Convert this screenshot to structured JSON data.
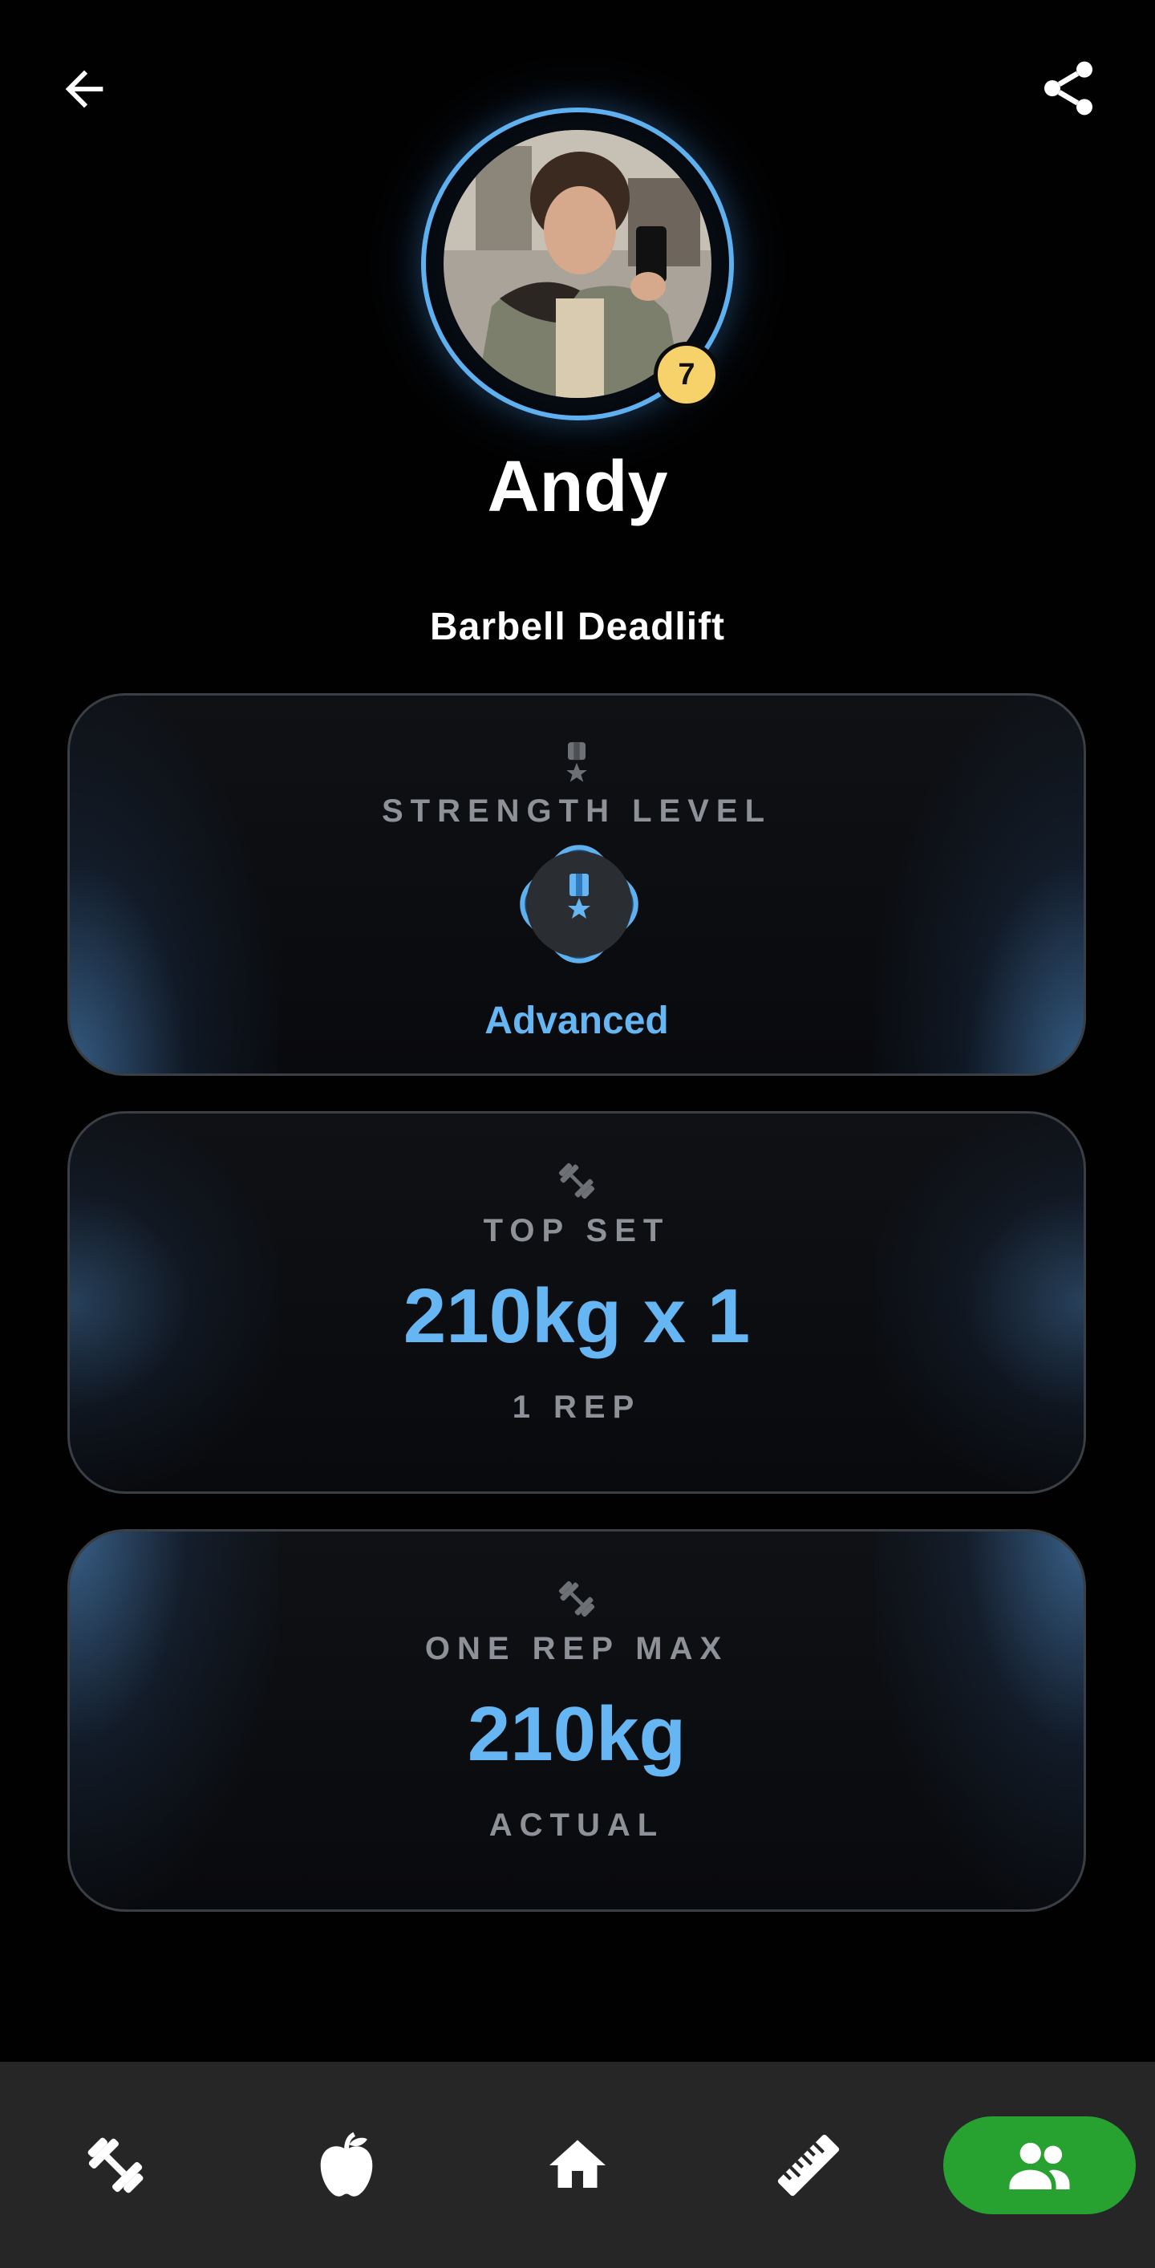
{
  "header": {
    "back_icon": "arrow-left-icon",
    "share_icon": "share-icon"
  },
  "profile": {
    "name": "Andy",
    "level": "7",
    "ring_color": "#5fb0ef",
    "badge_color": "#f7d26b"
  },
  "exercise": {
    "title": "Barbell Deadlift"
  },
  "cards": {
    "strength": {
      "label": "STRENGTH LEVEL",
      "value": "Advanced",
      "icon": "medal-icon"
    },
    "top_set": {
      "label": "TOP SET",
      "value": "210kg x 1",
      "sub": "1 REP",
      "icon": "dumbbell-icon"
    },
    "one_rep_max": {
      "label": "ONE REP MAX",
      "value": "210kg",
      "sub": "ACTUAL",
      "icon": "dumbbell-icon"
    }
  },
  "colors": {
    "accent": "#66b6f4",
    "nav_active": "#27a12f",
    "nav_bg": "#262626"
  },
  "nav": {
    "items": [
      {
        "name": "workouts",
        "icon": "dumbbell-icon",
        "active": false
      },
      {
        "name": "nutrition",
        "icon": "apple-icon",
        "active": false
      },
      {
        "name": "home",
        "icon": "home-icon",
        "active": false
      },
      {
        "name": "measurements",
        "icon": "ruler-icon",
        "active": false
      },
      {
        "name": "social",
        "icon": "people-icon",
        "active": true
      }
    ]
  }
}
